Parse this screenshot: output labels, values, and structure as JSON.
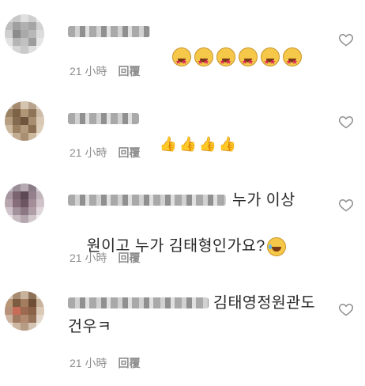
{
  "comments": [
    {
      "text": "",
      "emoji": [
        "star-struck",
        "star-struck",
        "star-struck",
        "star-struck",
        "star-struck",
        "star-struck"
      ],
      "time": "21 小時",
      "reply": "回覆"
    },
    {
      "text": "",
      "emoji": [
        "thumbs-up",
        "thumbs-up",
        "thumbs-up",
        "thumbs-up"
      ],
      "time": "21 小時",
      "reply": "回覆"
    },
    {
      "text_line1": "누가 이상",
      "text_line2": "원이고 누가 김태형인가요?",
      "emoji": [
        "joy"
      ],
      "time": "21 小時",
      "reply": "回覆"
    },
    {
      "text_line1": "김태영정원관도",
      "text_line2": "건우ㅋ",
      "time": "21 小時",
      "reply": "回覆"
    }
  ],
  "icons": {
    "like": "heart-outline-icon"
  },
  "colors": {
    "meta": "#8e8e8e",
    "text": "#262626"
  }
}
